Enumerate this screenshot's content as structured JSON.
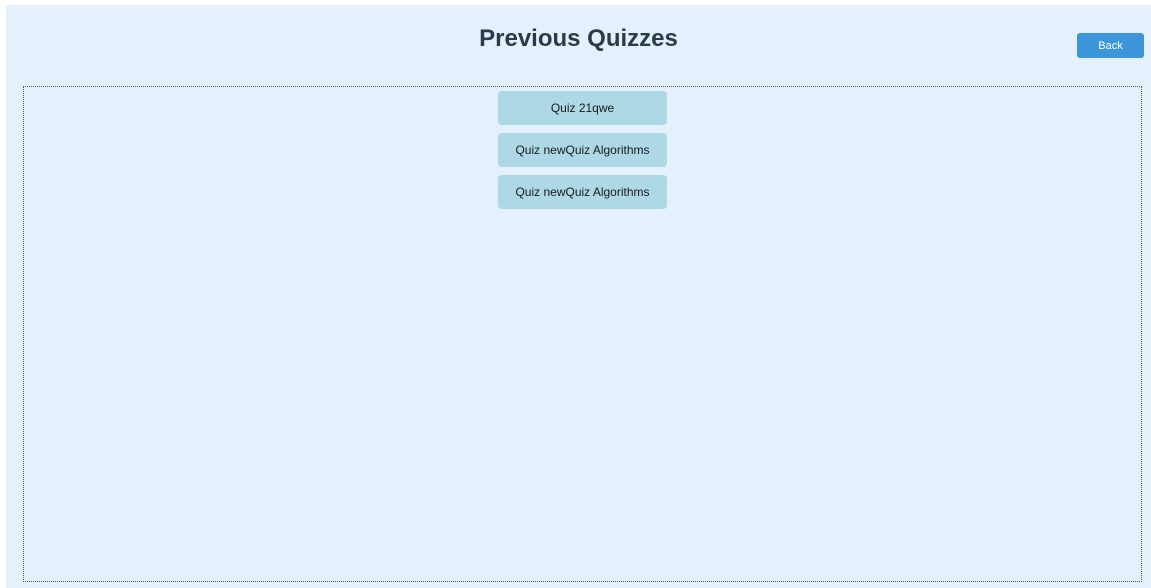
{
  "header": {
    "title": "Previous Quizzes",
    "back_label": "Back"
  },
  "quizzes": [
    {
      "label": "Quiz 21qwe"
    },
    {
      "label": "Quiz newQuiz Algorithms"
    },
    {
      "label": "Quiz newQuiz Algorithms"
    }
  ],
  "colors": {
    "background": "#e4f0fc",
    "accent": "#3c96d9",
    "quiz_button": "#add8e6",
    "title_text": "#2c3a4e"
  }
}
